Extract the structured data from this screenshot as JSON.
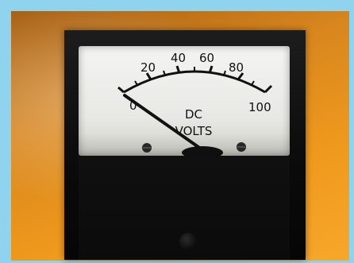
{
  "meter": {
    "scale": {
      "min": 0,
      "max": 100,
      "tick_labels": [
        "0",
        "20",
        "40",
        "60",
        "80",
        "100"
      ],
      "unit_line1": "DC",
      "unit_line2": "VOLTS"
    },
    "reading": 0,
    "colors": {
      "border": "#8fd3ee",
      "background": "#f09a1d",
      "face": "#eeeeea",
      "body": "#0b0b0b",
      "needle": "#111111"
    }
  }
}
